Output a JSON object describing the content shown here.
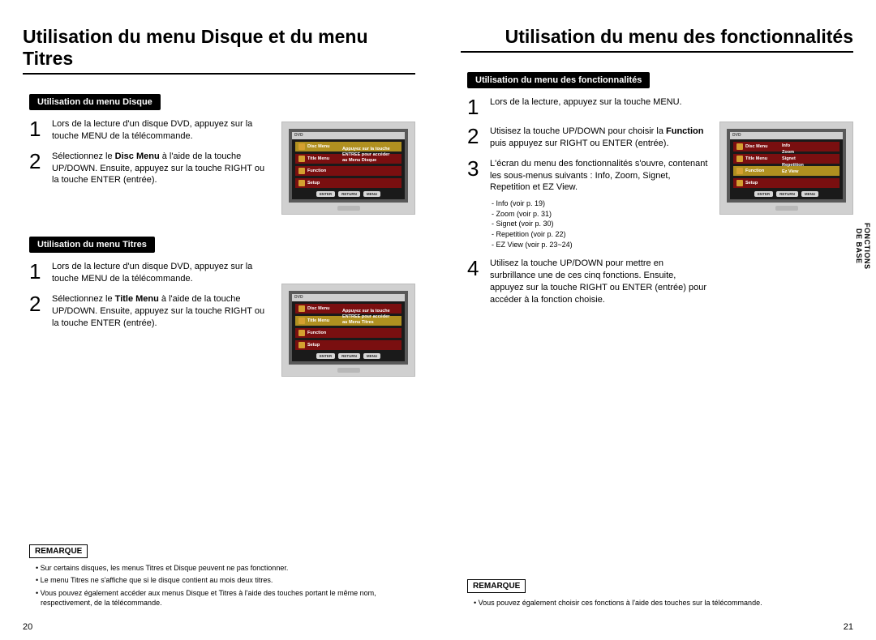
{
  "left": {
    "title": "Utilisation du menu Disque et du menu Titres",
    "page_num": "20",
    "disc": {
      "chip": "Utilisation du menu Disque",
      "step1": "Lors de la lecture d'un disque DVD, appuyez sur la touche MENU de la télécommande.",
      "step2_pre": "Sélectionnez le ",
      "step2_bold": "Disc Menu",
      "step2_post": " à l'aide de la touche UP/DOWN. Ensuite, appuyez sur la touche RIGHT ou la touche ENTER (entrée)."
    },
    "titre": {
      "chip": "Utilisation du menu Titres",
      "step1": "Lors de la lecture d'un disque DVD, appuyez sur la touche MENU de la télécommande.",
      "step2_pre": "Sélectionnez le ",
      "step2_bold": "Title Menu",
      "step2_post": " à l'aide de la touche UP/DOWN. Ensuite, appuyez sur la touche RIGHT ou la touche ENTER (entrée)."
    },
    "remarque": {
      "label": "REMARQUE",
      "items": [
        "Sur certains disques, les menus Titres et Disque peuvent ne pas fonctionner.",
        "Le menu Titres ne s'affiche que si le disque contient au mois deux titres.",
        "Vous pouvez également accéder aux menus Disque et Titres à l'aide des touches portant le même nom, respectivement, de la télécommande."
      ]
    },
    "tv": {
      "bar": "DVD",
      "rows": [
        "Disc Menu",
        "Title Menu",
        "Function",
        "Setup"
      ],
      "msg_disc": "Appuyez sur la touche\nENTREE pour accéder\nau Menu Disque",
      "msg_titre": "Appuyez sur la touche\nENTREE pour accéder\nau Menu Titres",
      "btns": [
        "ENTER",
        "RETURN",
        "MENU"
      ]
    }
  },
  "right": {
    "title": "Utilisation du menu des fonctionnalités",
    "page_num": "21",
    "side_tab": "FONCTIONS\nDE BASE",
    "func": {
      "chip": "Utilisation du menu des fonctionnalités",
      "step1": "Lors de la lecture, appuyez sur la touche MENU.",
      "step2_pre": "Utisisez la touche UP/DOWN  pour choisir la ",
      "step2_bold": "Function",
      "step2_post": " puis appuyez sur RIGHT ou ENTER (entrée).",
      "step3": "L'écran du menu des fonctionnalités s'ouvre, contenant les sous-menus suivants : Info, Zoom, Signet, Repetition et EZ View.",
      "step3_sub": [
        "Info (voir p. 19)",
        "Zoom (voir p. 31)",
        "Signet (voir p. 30)",
        "Repetition (voir p. 22)",
        "EZ View (voir p. 23~24)"
      ],
      "step4": "Utilisez la touche UP/DOWN pour mettre en surbrillance une de ces cinq fonctions. Ensuite, appuyez sur la touche RIGHT ou ENTER (entrée) pour accéder à la fonction choisie."
    },
    "remarque": {
      "label": "REMARQUE",
      "items": [
        "Vous pouvez également choisir ces fonctions à l'aide des touches sur la télécommande."
      ]
    },
    "tv": {
      "bar": "DVD",
      "rows": [
        "Disc Menu",
        "Title Menu",
        "Function",
        "Setup"
      ],
      "submenu": [
        "Info",
        "Zoom",
        "Signet",
        "Repetition",
        "Ez View"
      ],
      "btns": [
        "ENTER",
        "RETURN",
        "MENU"
      ]
    }
  }
}
